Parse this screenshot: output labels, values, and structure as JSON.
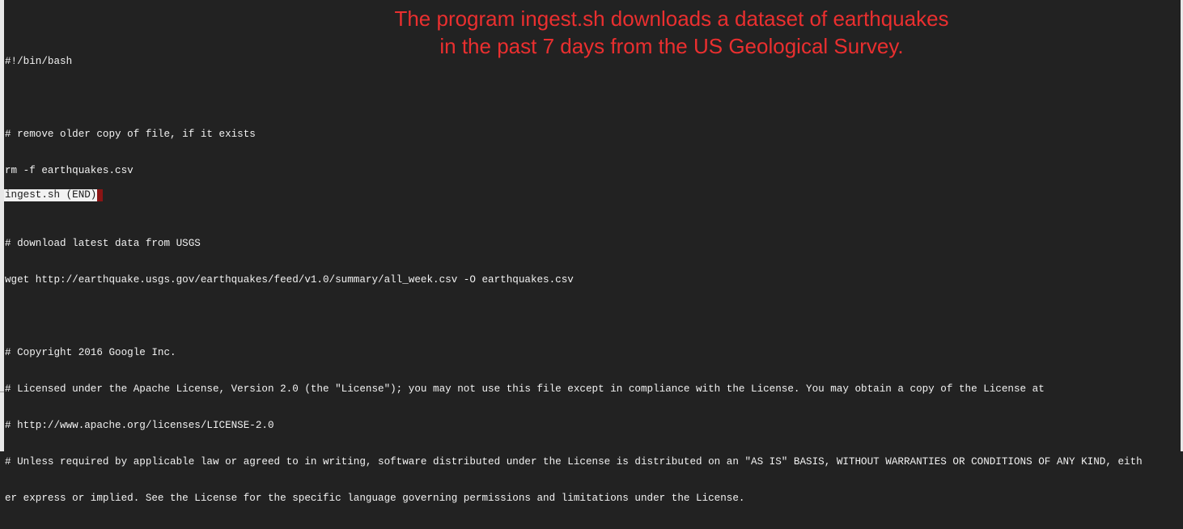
{
  "annotation": {
    "line1": "The program ingest.sh downloads a dataset of earthquakes",
    "line2": "in the past 7 days from the US Geological Survey."
  },
  "file": {
    "lines": [
      "#!/bin/bash",
      "",
      "# remove older copy of file, if it exists",
      "rm -f earthquakes.csv",
      "",
      "# download latest data from USGS",
      "wget http://earthquake.usgs.gov/earthquakes/feed/v1.0/summary/all_week.csv -O earthquakes.csv",
      "",
      "# Copyright 2016 Google Inc.",
      "# Licensed under the Apache License, Version 2.0 (the \"License\"); you may not use this file except in compliance with the License. You may obtain a copy of the License at",
      "# http://www.apache.org/licenses/LICENSE-2.0",
      "# Unless required by applicable law or agreed to in writing, software distributed under the License is distributed on an \"AS IS\" BASIS, WITHOUT WARRANTIES OR CONDITIONS OF ANY KIND, eith",
      "er express or implied. See the License for the specific language governing permissions and limitations under the License."
    ]
  },
  "pager": {
    "status": "ingest.sh (END)"
  },
  "colors": {
    "background": "#222222",
    "text": "#f2f2f2",
    "annotation": "#ea2f2f",
    "cursor": "#8b1414"
  }
}
